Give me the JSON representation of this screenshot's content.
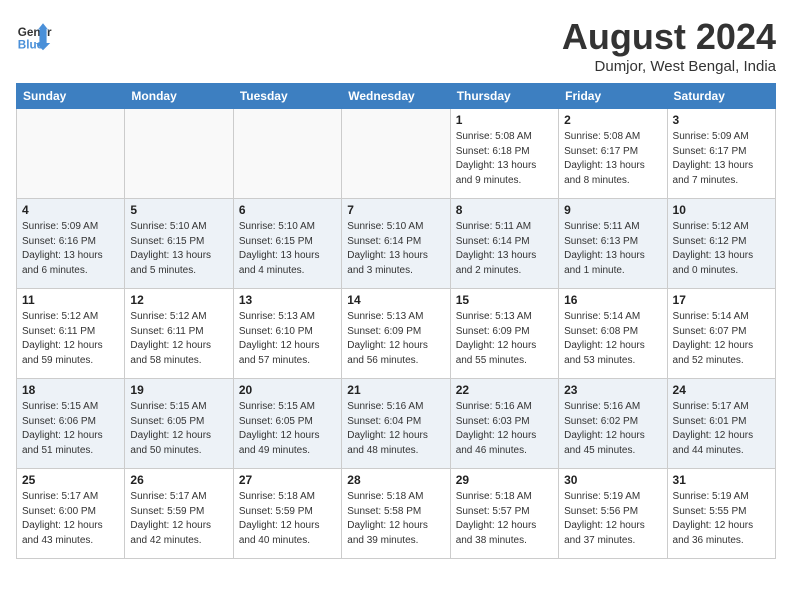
{
  "logo": {
    "line1": "General",
    "line2": "Blue"
  },
  "title": "August 2024",
  "location": "Dumjor, West Bengal, India",
  "days_of_week": [
    "Sunday",
    "Monday",
    "Tuesday",
    "Wednesday",
    "Thursday",
    "Friday",
    "Saturday"
  ],
  "weeks": [
    [
      {
        "day": "",
        "info": ""
      },
      {
        "day": "",
        "info": ""
      },
      {
        "day": "",
        "info": ""
      },
      {
        "day": "",
        "info": ""
      },
      {
        "day": "1",
        "info": "Sunrise: 5:08 AM\nSunset: 6:18 PM\nDaylight: 13 hours\nand 9 minutes."
      },
      {
        "day": "2",
        "info": "Sunrise: 5:08 AM\nSunset: 6:17 PM\nDaylight: 13 hours\nand 8 minutes."
      },
      {
        "day": "3",
        "info": "Sunrise: 5:09 AM\nSunset: 6:17 PM\nDaylight: 13 hours\nand 7 minutes."
      }
    ],
    [
      {
        "day": "4",
        "info": "Sunrise: 5:09 AM\nSunset: 6:16 PM\nDaylight: 13 hours\nand 6 minutes."
      },
      {
        "day": "5",
        "info": "Sunrise: 5:10 AM\nSunset: 6:15 PM\nDaylight: 13 hours\nand 5 minutes."
      },
      {
        "day": "6",
        "info": "Sunrise: 5:10 AM\nSunset: 6:15 PM\nDaylight: 13 hours\nand 4 minutes."
      },
      {
        "day": "7",
        "info": "Sunrise: 5:10 AM\nSunset: 6:14 PM\nDaylight: 13 hours\nand 3 minutes."
      },
      {
        "day": "8",
        "info": "Sunrise: 5:11 AM\nSunset: 6:14 PM\nDaylight: 13 hours\nand 2 minutes."
      },
      {
        "day": "9",
        "info": "Sunrise: 5:11 AM\nSunset: 6:13 PM\nDaylight: 13 hours\nand 1 minute."
      },
      {
        "day": "10",
        "info": "Sunrise: 5:12 AM\nSunset: 6:12 PM\nDaylight: 13 hours\nand 0 minutes."
      }
    ],
    [
      {
        "day": "11",
        "info": "Sunrise: 5:12 AM\nSunset: 6:11 PM\nDaylight: 12 hours\nand 59 minutes."
      },
      {
        "day": "12",
        "info": "Sunrise: 5:12 AM\nSunset: 6:11 PM\nDaylight: 12 hours\nand 58 minutes."
      },
      {
        "day": "13",
        "info": "Sunrise: 5:13 AM\nSunset: 6:10 PM\nDaylight: 12 hours\nand 57 minutes."
      },
      {
        "day": "14",
        "info": "Sunrise: 5:13 AM\nSunset: 6:09 PM\nDaylight: 12 hours\nand 56 minutes."
      },
      {
        "day": "15",
        "info": "Sunrise: 5:13 AM\nSunset: 6:09 PM\nDaylight: 12 hours\nand 55 minutes."
      },
      {
        "day": "16",
        "info": "Sunrise: 5:14 AM\nSunset: 6:08 PM\nDaylight: 12 hours\nand 53 minutes."
      },
      {
        "day": "17",
        "info": "Sunrise: 5:14 AM\nSunset: 6:07 PM\nDaylight: 12 hours\nand 52 minutes."
      }
    ],
    [
      {
        "day": "18",
        "info": "Sunrise: 5:15 AM\nSunset: 6:06 PM\nDaylight: 12 hours\nand 51 minutes."
      },
      {
        "day": "19",
        "info": "Sunrise: 5:15 AM\nSunset: 6:05 PM\nDaylight: 12 hours\nand 50 minutes."
      },
      {
        "day": "20",
        "info": "Sunrise: 5:15 AM\nSunset: 6:05 PM\nDaylight: 12 hours\nand 49 minutes."
      },
      {
        "day": "21",
        "info": "Sunrise: 5:16 AM\nSunset: 6:04 PM\nDaylight: 12 hours\nand 48 minutes."
      },
      {
        "day": "22",
        "info": "Sunrise: 5:16 AM\nSunset: 6:03 PM\nDaylight: 12 hours\nand 46 minutes."
      },
      {
        "day": "23",
        "info": "Sunrise: 5:16 AM\nSunset: 6:02 PM\nDaylight: 12 hours\nand 45 minutes."
      },
      {
        "day": "24",
        "info": "Sunrise: 5:17 AM\nSunset: 6:01 PM\nDaylight: 12 hours\nand 44 minutes."
      }
    ],
    [
      {
        "day": "25",
        "info": "Sunrise: 5:17 AM\nSunset: 6:00 PM\nDaylight: 12 hours\nand 43 minutes."
      },
      {
        "day": "26",
        "info": "Sunrise: 5:17 AM\nSunset: 5:59 PM\nDaylight: 12 hours\nand 42 minutes."
      },
      {
        "day": "27",
        "info": "Sunrise: 5:18 AM\nSunset: 5:59 PM\nDaylight: 12 hours\nand 40 minutes."
      },
      {
        "day": "28",
        "info": "Sunrise: 5:18 AM\nSunset: 5:58 PM\nDaylight: 12 hours\nand 39 minutes."
      },
      {
        "day": "29",
        "info": "Sunrise: 5:18 AM\nSunset: 5:57 PM\nDaylight: 12 hours\nand 38 minutes."
      },
      {
        "day": "30",
        "info": "Sunrise: 5:19 AM\nSunset: 5:56 PM\nDaylight: 12 hours\nand 37 minutes."
      },
      {
        "day": "31",
        "info": "Sunrise: 5:19 AM\nSunset: 5:55 PM\nDaylight: 12 hours\nand 36 minutes."
      }
    ]
  ]
}
